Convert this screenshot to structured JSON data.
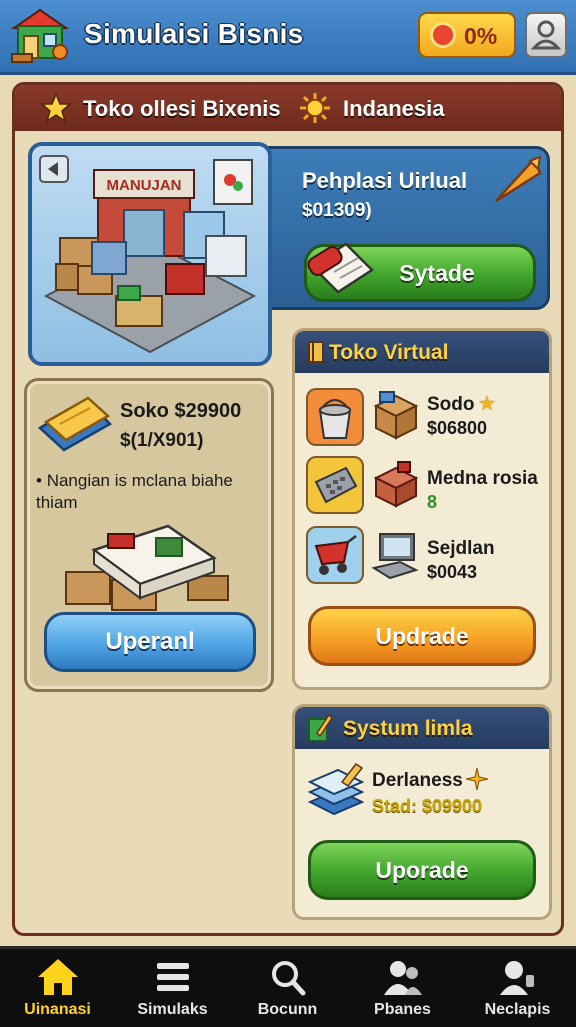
{
  "header": {
    "title": "Simulaisi Bisnis",
    "currency_label": "0%",
    "colors": {
      "bar": "#3a7cc2",
      "accent": "#ffd21c"
    },
    "icons": {
      "logo": "shop-logo-icon",
      "currency": "coin-icon",
      "profile": "profile-icon"
    }
  },
  "banner": {
    "left_text": "Toko ollesi Bixenis",
    "right_text": "Indanesia",
    "icons": [
      "star-icon",
      "sun-icon"
    ]
  },
  "featured": {
    "sign_text": "MANUJAN",
    "title": "Pehplasi Uirlual",
    "price": "$01309)",
    "button_label": "Sytade",
    "icons": [
      "back-arrow-icon",
      "scroll-icon",
      "carrot-icon",
      "shop-scene-icon"
    ]
  },
  "offer": {
    "title": "Soko $29900",
    "subtitle": "$(1/X901)",
    "bullet": "Nangian is mclana biahe thiam",
    "button_label": "Uperanl",
    "icons": [
      "ticket-icon",
      "book-icon",
      "crates-icon"
    ]
  },
  "shop": {
    "title": "Toko Virtual",
    "items": [
      {
        "name": "Sodo",
        "price": "$06800",
        "icons": [
          "bucket-icon",
          "box-icon",
          "star-icon"
        ]
      },
      {
        "name": "Medna rosia",
        "price": "8",
        "icons": [
          "cash-register-icon",
          "box-open-icon"
        ]
      },
      {
        "name": "Sejdlan",
        "price": "$0043",
        "icons": [
          "cart-icon",
          "computer-icon"
        ]
      }
    ],
    "button_label": "Updrade"
  },
  "system": {
    "title": "Systum limla",
    "item_name": "Derlaness",
    "item_value": "Stad: $09900",
    "button_label": "Uporade",
    "icons": [
      "pencil-icon",
      "books-icon",
      "sparkle-icon"
    ]
  },
  "nav": {
    "items": [
      {
        "label": "Uinanasi",
        "icon": "home-icon",
        "active": true
      },
      {
        "label": "Simulaks",
        "icon": "list-icon",
        "active": false
      },
      {
        "label": "Bocunn",
        "icon": "search-icon",
        "active": false
      },
      {
        "label": "Pbanes",
        "icon": "users-icon",
        "active": false
      },
      {
        "label": "Neclapis",
        "icon": "support-icon",
        "active": false
      }
    ]
  }
}
